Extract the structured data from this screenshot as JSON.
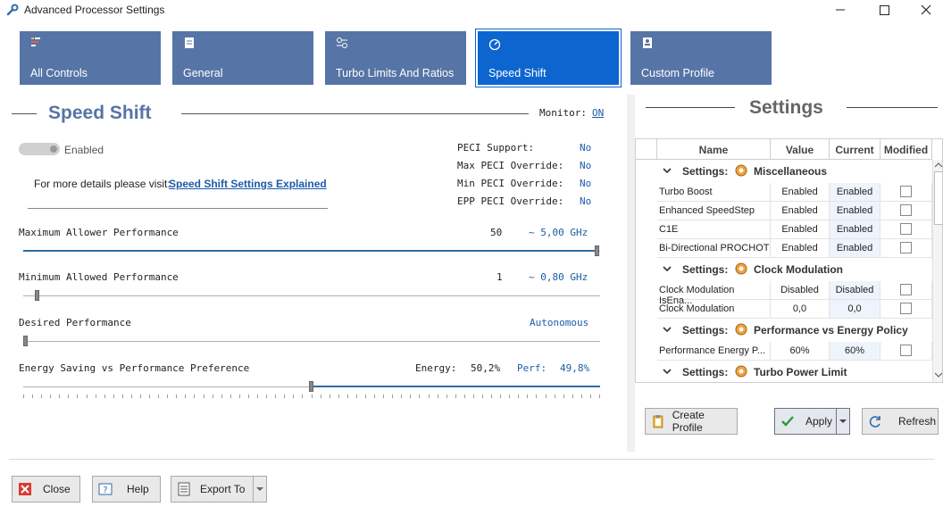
{
  "window": {
    "title": "Advanced Processor Settings"
  },
  "tabs": [
    {
      "label": "All Controls",
      "icon": "all-controls-icon"
    },
    {
      "label": "General",
      "icon": "general-icon"
    },
    {
      "label": "Turbo Limits And Ratios",
      "icon": "turbo-limits-icon"
    },
    {
      "label": "Speed Shift",
      "icon": "speed-shift-icon",
      "active": true
    },
    {
      "label": "Custom Profile",
      "icon": "custom-profile-icon"
    }
  ],
  "speed_shift": {
    "title": "Speed Shift",
    "monitor_label": "Monitor:",
    "monitor_value": "ON",
    "toggle_label": "Enabled",
    "details_text": "For more details please visit:",
    "details_link": "Speed Shift Settings Explained",
    "peci": [
      {
        "label": "PECI Support:",
        "value": "No"
      },
      {
        "label": "Max PECI Override:",
        "value": "No"
      },
      {
        "label": "Min PECI Override:",
        "value": "No"
      },
      {
        "label": "EPP PECI Override:",
        "value": "No"
      }
    ],
    "sliders": [
      {
        "label": "Maximum Allower Performance",
        "value": "50",
        "freq": "~ 5,00 GHz",
        "level": 1.0
      },
      {
        "label": "Minimum Allowed Performance",
        "value": "1",
        "freq": "~ 0,80 GHz",
        "level": 0.02
      },
      {
        "label": "Desired Performance",
        "value": "",
        "freq": "Autonomous",
        "level": 0.0
      }
    ],
    "energy": {
      "label": "Energy Saving vs Performance Preference",
      "energy_label": "Energy:",
      "energy_value": "50,2%",
      "perf_label": "Perf:",
      "perf_value": "49,8%",
      "level": 0.5
    }
  },
  "settings": {
    "title": "Settings",
    "columns": [
      "Name",
      "Value",
      "Current",
      "Modified"
    ],
    "groups": [
      {
        "label": "Settings:",
        "name": "Miscellaneous",
        "rows": [
          {
            "name": "Turbo Boost",
            "value": "Enabled",
            "current": "Enabled"
          },
          {
            "name": "Enhanced SpeedStep",
            "value": "Enabled",
            "current": "Enabled"
          },
          {
            "name": "C1E",
            "value": "Enabled",
            "current": "Enabled"
          },
          {
            "name": "Bi-Directional PROCHOT",
            "value": "Enabled",
            "current": "Enabled"
          }
        ]
      },
      {
        "label": "Settings:",
        "name": "Clock Modulation",
        "rows": [
          {
            "name": "Clock Modulation IsEna...",
            "value": "Disabled",
            "current": "Disabled"
          },
          {
            "name": "Clock Modulation",
            "value": "0,0",
            "current": "0,0"
          }
        ]
      },
      {
        "label": "Settings:",
        "name": "Performance vs Energy Policy",
        "rows": [
          {
            "name": "Performance Energy P...",
            "value": "60%",
            "current": "60%"
          }
        ]
      },
      {
        "label": "Settings:",
        "name": "Turbo Power Limit",
        "rows": []
      }
    ]
  },
  "actions": {
    "create_profile": "Create Profile",
    "apply": "Apply",
    "refresh": "Refresh"
  },
  "footer": {
    "close": "Close",
    "help": "Help",
    "export": "Export To"
  },
  "colors": {
    "tab": "#5774a6",
    "tab_active": "#0d66d0",
    "title_blue": "#5774a6",
    "link_blue": "#1d5ba8"
  }
}
